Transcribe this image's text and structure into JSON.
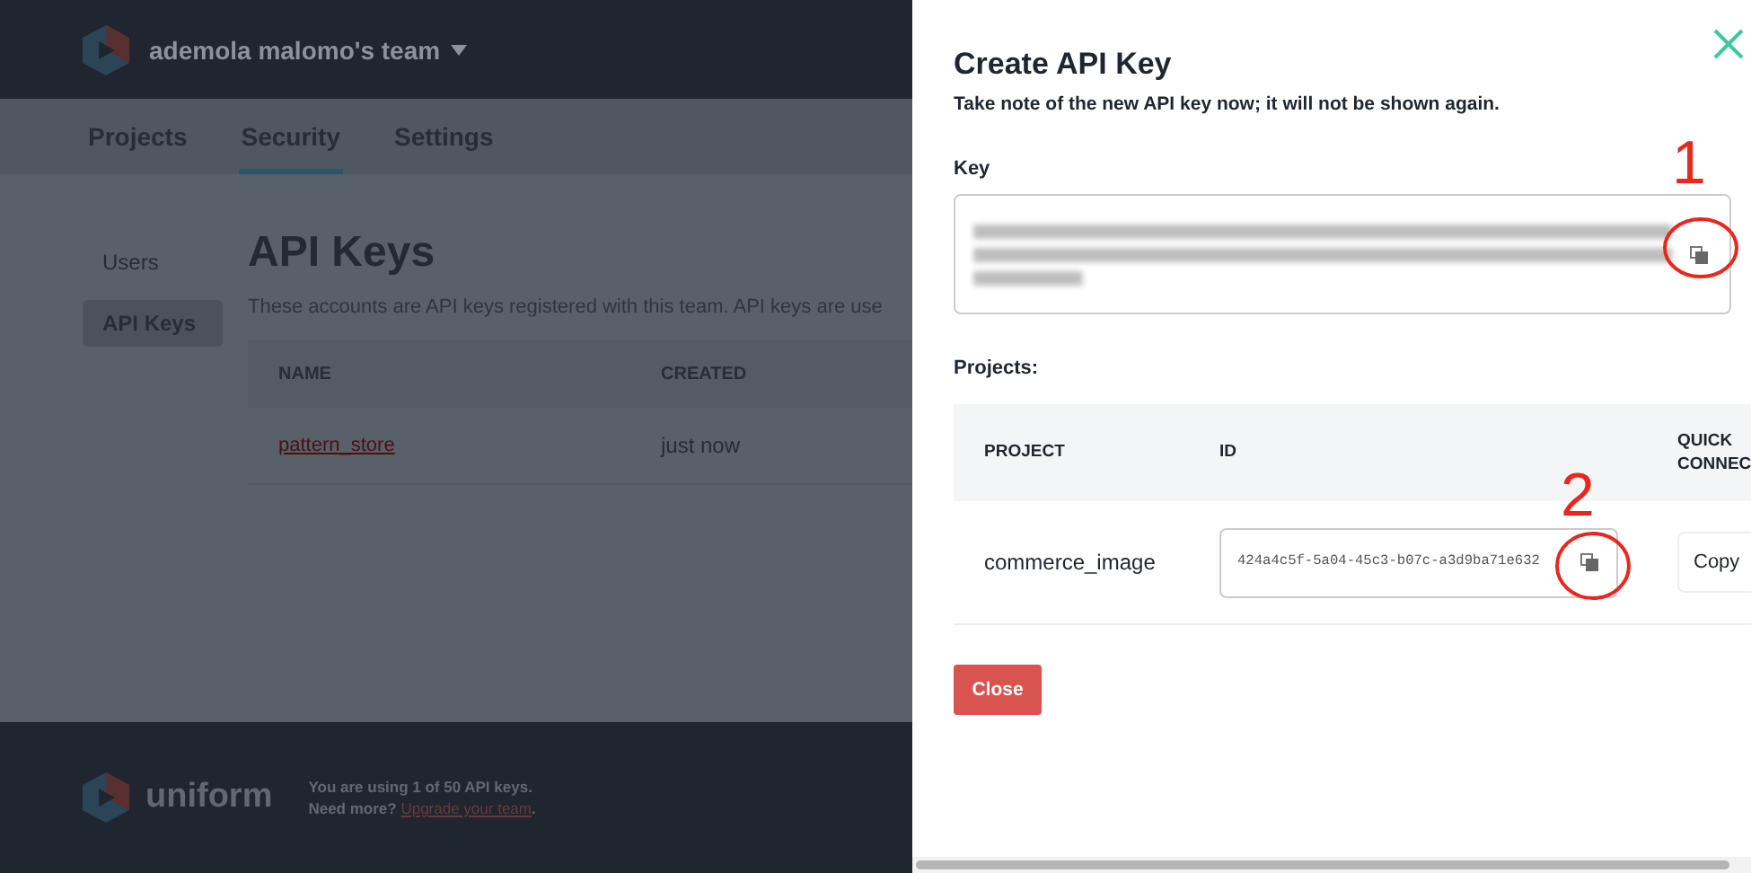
{
  "header": {
    "team": "ademola malomo's team"
  },
  "nav_tabs": [
    {
      "label": "Projects",
      "selected": false
    },
    {
      "label": "Security",
      "selected": true
    },
    {
      "label": "Settings",
      "selected": false
    }
  ],
  "sidebar": {
    "items": [
      {
        "label": "Users",
        "selected": false
      },
      {
        "label": "API Keys",
        "selected": true
      }
    ]
  },
  "page": {
    "title": "API Keys",
    "description": "These accounts are API keys registered with this team. API keys are use",
    "columns": [
      "NAME",
      "CREATED"
    ],
    "rows": [
      {
        "name": "pattern_store",
        "created": "just now"
      }
    ]
  },
  "footer": {
    "brand": "uniform",
    "usage": "You are using 1 of 50 API keys.",
    "prompt": "Need more?",
    "link": "Upgrade your team",
    "end": "."
  },
  "drawer": {
    "title": "Create API Key",
    "subtitle": "Take note of the new API key now; it will not be shown again.",
    "key_label": "Key",
    "projects_label": "Projects:",
    "columns": [
      "PROJECT",
      "ID",
      "QUICK CONNEC"
    ],
    "rows": [
      {
        "project": "commerce_image",
        "id": "424a4c5f-5a04-45c3-b07c-a3d9ba71e632",
        "action": "Copy"
      }
    ],
    "close": "Close",
    "annotations": [
      "1",
      "2"
    ]
  }
}
